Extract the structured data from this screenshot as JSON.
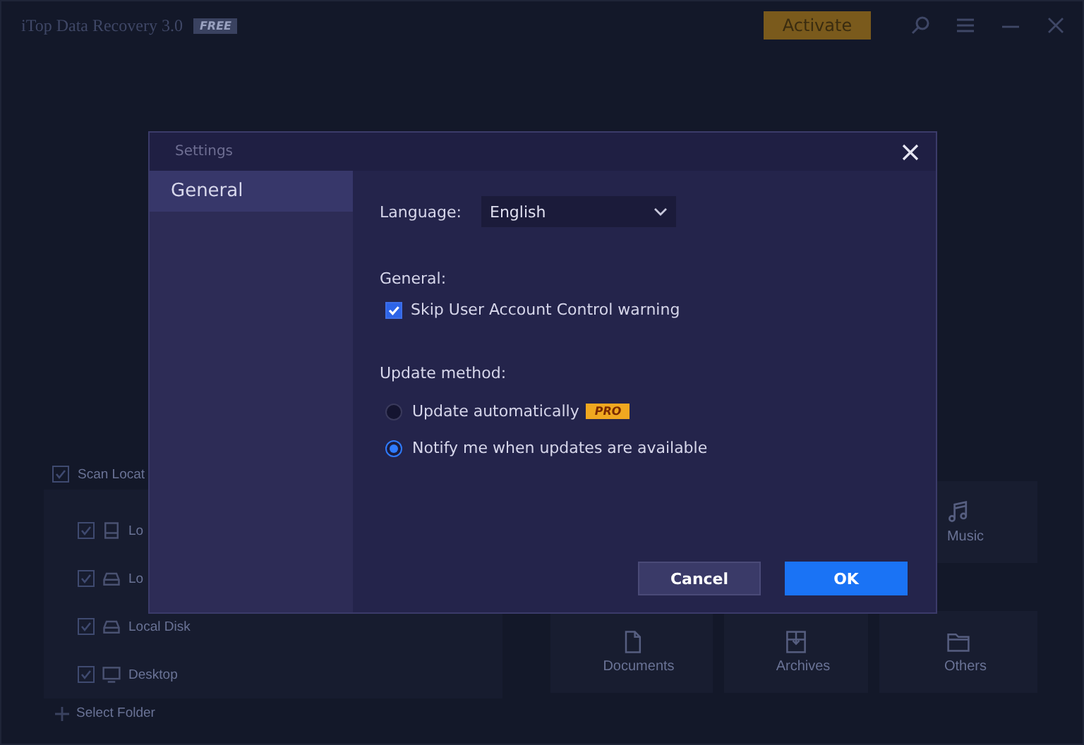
{
  "app": {
    "title": "iTop Data Recovery 3.0",
    "edition": "FREE",
    "activate": "Activate"
  },
  "scan": {
    "label": "Scan Locat",
    "checked": true,
    "locations": [
      {
        "label": "Lo",
        "kind": "drive",
        "checked": true
      },
      {
        "label": "Lo",
        "kind": "disk",
        "checked": true
      },
      {
        "label": "Local Disk",
        "kind": "disk",
        "checked": true
      },
      {
        "label": "Desktop",
        "kind": "desktop",
        "checked": true
      }
    ],
    "select_folder": "Select Folder"
  },
  "file_types": [
    {
      "label": "Music",
      "kind": "music"
    },
    {
      "label": "Documents",
      "kind": "document"
    },
    {
      "label": "Archives",
      "kind": "archive"
    },
    {
      "label": "Others",
      "kind": "folder"
    }
  ],
  "dialog": {
    "title": "Settings",
    "nav": [
      {
        "label": "General",
        "selected": true
      }
    ],
    "language_label": "Language:",
    "language": "English",
    "general_heading": "General:",
    "options": [
      {
        "label": "Skip User Account Control warning",
        "checked": true
      }
    ],
    "update_heading": "Update method:",
    "update_methods": [
      {
        "label": "Update automatically",
        "badge": "PRO",
        "selected": false
      },
      {
        "label": "Notify me when updates are available",
        "selected": true
      }
    ],
    "buttons": [
      {
        "label": "Cancel",
        "kind": "secondary"
      },
      {
        "label": "OK",
        "kind": "primary"
      }
    ]
  }
}
